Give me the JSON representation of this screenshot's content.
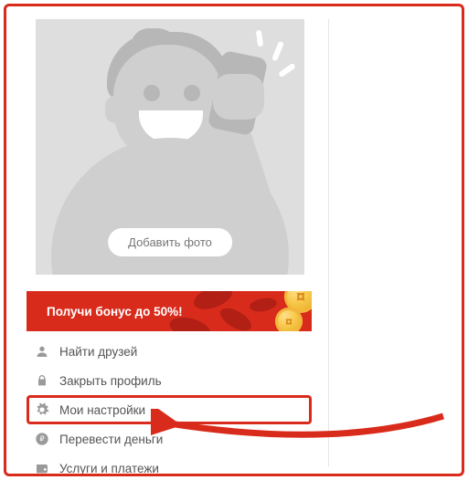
{
  "avatar": {
    "add_photo_label": "Добавить фото"
  },
  "bonus": {
    "text": "Получи бонус до 50%!"
  },
  "menu": {
    "items": [
      {
        "id": "find-friends",
        "label": "Найти друзей",
        "icon": "person-icon",
        "highlight": false
      },
      {
        "id": "close-profile",
        "label": "Закрыть профиль",
        "icon": "lock-icon",
        "highlight": false
      },
      {
        "id": "my-settings",
        "label": "Мои настройки",
        "icon": "gear-icon",
        "highlight": true
      },
      {
        "id": "transfer-money",
        "label": "Перевести деньги",
        "icon": "ruble-icon",
        "highlight": false
      },
      {
        "id": "services",
        "label": "Услуги и платежи",
        "icon": "wallet-icon",
        "highlight": false
      }
    ]
  }
}
